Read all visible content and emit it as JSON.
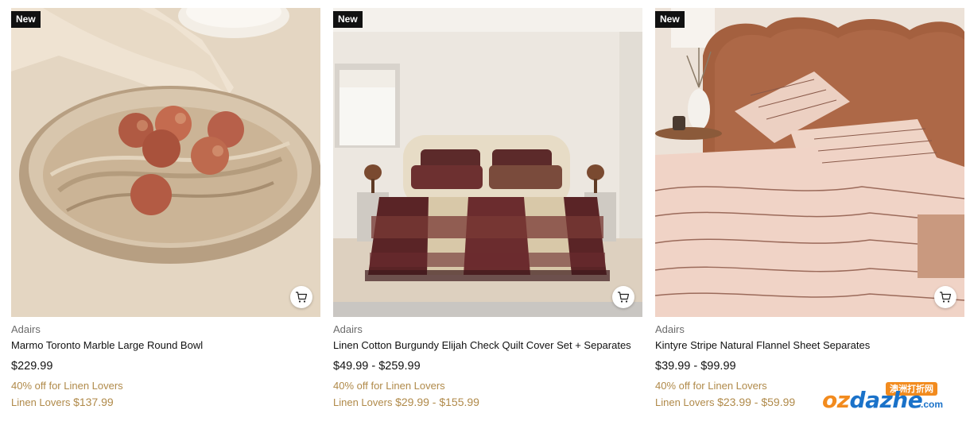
{
  "products": [
    {
      "badge": "New",
      "brand": "Adairs",
      "title": "Marmo Toronto Marble Large Round Bowl",
      "price": "$229.99",
      "offer": "40% off for Linen Lovers",
      "member_label": "Linen Lovers",
      "member_price": "$137.99",
      "cart_icon": "shopping-cart-icon"
    },
    {
      "badge": "New",
      "brand": "Adairs",
      "title": "Linen Cotton Burgundy Elijah Check Quilt Cover Set + Separates",
      "price": "$49.99 - $259.99",
      "offer": "40% off for Linen Lovers",
      "member_label": "Linen Lovers",
      "member_price": "$29.99 - $155.99",
      "cart_icon": "shopping-cart-icon"
    },
    {
      "badge": "New",
      "brand": "Adairs",
      "title": "Kintyre Stripe Natural Flannel Sheet Separates",
      "price": "$39.99 - $99.99",
      "offer": "40% off for Linen Lovers",
      "member_label": "Linen Lovers",
      "member_price": "$23.99 - $59.99",
      "cart_icon": "shopping-cart-icon"
    }
  ],
  "watermark": {
    "tag": "澳洲打折网",
    "logo_prefix": "oz",
    "logo_rest": "dazhe",
    "domain": ".com"
  },
  "colors": {
    "offer": "#b08a4a",
    "badge_bg": "#111111",
    "price": "#111111",
    "brand": "#6b6b6b"
  }
}
